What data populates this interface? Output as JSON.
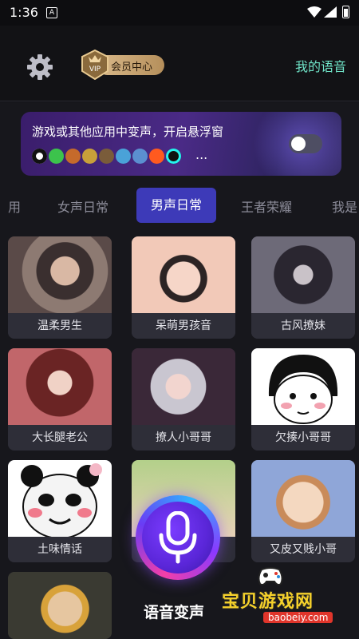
{
  "status_bar": {
    "time": "1:36",
    "notification_icon": "A"
  },
  "header": {
    "settings_icon": "gear-icon",
    "vip_badge_text": "VIP",
    "vip_center_label": "会员中心",
    "my_voice_label": "我的语音"
  },
  "banner": {
    "text": "游戏或其他应用中变声，开启悬浮窗",
    "ellipsis": "...",
    "toggle_on": false
  },
  "tabs": [
    {
      "label": "用",
      "active": false
    },
    {
      "label": "女声日常",
      "active": false
    },
    {
      "label": "男声日常",
      "active": true
    },
    {
      "label": "王者荣耀",
      "active": false
    },
    {
      "label": "我是",
      "active": false
    }
  ],
  "voices": [
    {
      "label": "温柔男生"
    },
    {
      "label": "呆萌男孩音"
    },
    {
      "label": "古风撩妹"
    },
    {
      "label": "大长腿老公"
    },
    {
      "label": "撩人小哥哥"
    },
    {
      "label": "欠揍小哥哥"
    },
    {
      "label": "土味情话"
    },
    {
      "label": ""
    },
    {
      "label": "又皮又贱小哥"
    },
    {
      "label": ""
    }
  ],
  "mic_button": {
    "label": "语音变声"
  },
  "watermark": {
    "text": "宝贝游戏网",
    "url": "baobeiy.com"
  },
  "colors": {
    "accent": "#3d3ab8",
    "my_voice": "#6fe3c7",
    "vip_gold": "#c9a46e",
    "watermark_yellow": "#f5d12b"
  }
}
